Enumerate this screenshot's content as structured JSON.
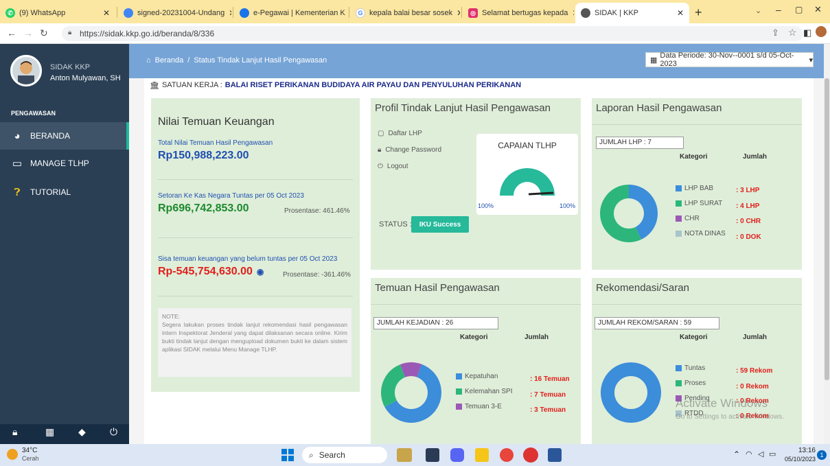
{
  "tabs": [
    {
      "label": "(9) WhatsApp",
      "icon": "whatsapp-icon",
      "color": "#25d366"
    },
    {
      "label": "signed-20231004-Undang",
      "icon": "chrome-tab-icon",
      "color": "#4285f4"
    },
    {
      "label": "e-Pegawai | Kementerian K",
      "icon": "globe-icon",
      "color": "#1a73e8"
    },
    {
      "label": "kepala balai besar sosek",
      "icon": "google-icon",
      "color": "#4285f4"
    },
    {
      "label": "Selamat bertugas kepada",
      "icon": "instagram-icon",
      "color": "#e1306c"
    },
    {
      "label": "SIDAK | KKP",
      "icon": "sidak-icon",
      "color": "#555555"
    }
  ],
  "url": "https://sidak.kkp.go.id/beranda/8/336",
  "sidebar": {
    "app_name": "SIDAK KKP",
    "user_name": "Anton Mulyawan, SH",
    "section": "PENGAWASAN",
    "items": [
      {
        "label": "BERANDA",
        "icon": "chart-pie-icon"
      },
      {
        "label": "MANAGE TLHP",
        "icon": "monitor-icon"
      },
      {
        "label": "TUTORIAL",
        "icon": "question-icon"
      }
    ]
  },
  "breadcrumb": {
    "home": "Beranda",
    "sep": "/",
    "current": "Status Tindak Lanjut Hasil Pengawasan"
  },
  "period": "Data Periode: 30-Nov--0001 s/d 05-Oct-2023",
  "satuan": {
    "label": "SATUAN KERJA :",
    "value": "BALAI RISET PERIKANAN BUDIDAYA AIR PAYAU DAN PENYULUHAN PERIKANAN"
  },
  "keuangan": {
    "title": "Nilai Temuan Keuangan",
    "total_label": "Total Nilai Temuan Hasil Pengawasan",
    "total_value": "Rp150,988,223.00",
    "setoran_label": "Setoran Ke Kas Negara Tuntas per 05 Oct 2023",
    "setoran_value": "Rp696,742,853.00",
    "setoran_pct": "Prosentase: 461.46%",
    "sisa_label": "Sisa temuan keuangan yang belum tuntas per 05 Oct 2023",
    "sisa_value": "Rp-545,754,630.00",
    "sisa_pct": "Prosentase: -361.46%",
    "note": "NOTE:\nSegera lakukan proses tindak lanjut rekomendasi hasil pengawasan intern Inspektorat Jenderal yang dapat dilaksanan secara online. Kirim bukti tindak lanjut dengan mengupload dokumen bukti ke dalam sistem aplikasi SIDAK melalui Menu Manage TLHP."
  },
  "profil": {
    "title": "Profil Tindak Lanjut Hasil Pengawasan",
    "links": [
      "Daftar LHP",
      "Change Password",
      "Logout"
    ],
    "gauge_title": "CAPAIAN TLHP",
    "gauge_min": "100%",
    "gauge_max": "100%",
    "gauge_value": 1.0,
    "status_label": "STATUS :",
    "status_value": "IKU Success"
  },
  "laporan": {
    "title": "Laporan Hasil Pengawasan",
    "jumlah": "JUMLAH LHP : 7",
    "kategori": "Kategori",
    "jumlah_hdr": "Jumlah",
    "items": [
      {
        "label": "LHP BAB",
        "value": ": 3 LHP",
        "color": "#3c8dda"
      },
      {
        "label": "LHP SURAT",
        "value": ": 4 LHP",
        "color": "#2db67c"
      },
      {
        "label": "CHR",
        "value": ": 0 CHR",
        "color": "#9b59b6"
      },
      {
        "label": "NOTA DINAS",
        "value": ": 0 DOK",
        "color": "#a8c4cc"
      }
    ]
  },
  "temuan": {
    "title": "Temuan Hasil Pengawasan",
    "jumlah": "JUMLAH KEJADIAN : 26",
    "kategori": "Kategori",
    "jumlah_hdr": "Jumlah",
    "items": [
      {
        "label": "Kepatuhan",
        "value": ": 16 Temuan",
        "color": "#3c8dda"
      },
      {
        "label": "Kelemahan SPI",
        "value": ": 7 Temuan",
        "color": "#2db67c"
      },
      {
        "label": "Temuan 3-E",
        "value": ": 3 Temuan",
        "color": "#9b59b6"
      }
    ]
  },
  "rekom": {
    "title": "Rekomendasi/Saran",
    "jumlah": "JUMLAH REKOM/SARAN : 59",
    "kategori": "Kategori",
    "jumlah_hdr": "Jumlah",
    "items": [
      {
        "label": "Tuntas",
        "value": ": 59 Rekom",
        "color": "#3c8dda"
      },
      {
        "label": "Proses",
        "value": ": 0 Rekom",
        "color": "#2db67c"
      },
      {
        "label": "Pending",
        "value": ": 0 Rekom",
        "color": "#9b59b6"
      },
      {
        "label": "RTDD",
        "value": ": 0 Rekom",
        "color": "#a8c4cc"
      }
    ]
  },
  "chart_data": [
    {
      "type": "pie",
      "title": "Laporan Hasil Pengawasan",
      "categories": [
        "LHP BAB",
        "LHP SURAT",
        "CHR",
        "NOTA DINAS"
      ],
      "values": [
        3,
        4,
        0,
        0
      ]
    },
    {
      "type": "pie",
      "title": "Temuan Hasil Pengawasan",
      "categories": [
        "Kepatuhan",
        "Kelemahan SPI",
        "Temuan 3-E"
      ],
      "values": [
        16,
        7,
        3
      ]
    },
    {
      "type": "pie",
      "title": "Rekomendasi/Saran",
      "categories": [
        "Tuntas",
        "Proses",
        "Pending",
        "RTDD"
      ],
      "values": [
        59,
        0,
        0,
        0
      ]
    }
  ],
  "watermark": {
    "line1": "Activate Windows",
    "line2": "Go to Settings to activate Windows."
  },
  "taskbar": {
    "temp": "34°C",
    "weather": "Cerah",
    "search": "Search",
    "time": "13:16",
    "date": "05/10/2023",
    "badge": "1"
  }
}
